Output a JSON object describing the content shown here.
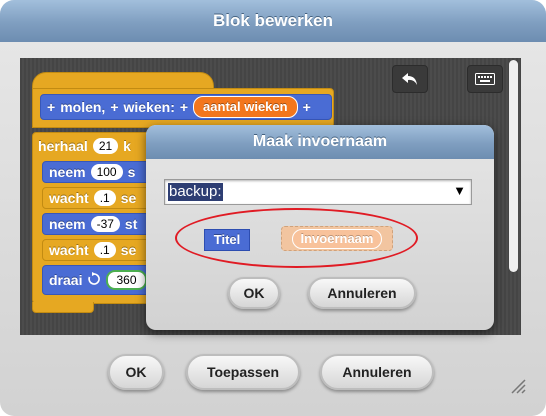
{
  "dialog": {
    "title": "Blok bewerken"
  },
  "toolbar": {
    "undo_icon": "undo-arrow-icon",
    "keyboard_icon": "keyboard-icon"
  },
  "hat_block": {
    "plus1": "+",
    "word1": "molen,",
    "plus2": "+",
    "word2": "wieken:",
    "plus3": "+",
    "param": "aantal wieken",
    "plus4": "+"
  },
  "script": {
    "repeat": {
      "label": "herhaal",
      "count": "21",
      "tail": "k"
    },
    "rows": [
      {
        "kind": "motion",
        "label": "neem",
        "value": "100",
        "tail": "s"
      },
      {
        "kind": "control",
        "label": "wacht",
        "value": ".1",
        "tail": "se"
      },
      {
        "kind": "motion",
        "label": "neem",
        "value": "-37",
        "tail": "st"
      },
      {
        "kind": "control",
        "label": "wacht",
        "value": ".1",
        "tail": "se"
      },
      {
        "kind": "motion",
        "label": "draai",
        "value": "360",
        "tail": ""
      }
    ]
  },
  "inner_dialog": {
    "title": "Maak invoernaam",
    "input_value": "backup:",
    "title_option": "Titel",
    "input_option": "Invoernaam",
    "ok_label": "OK",
    "cancel_label": "Annuleren"
  },
  "buttons": {
    "ok": "OK",
    "apply": "Toepassen",
    "cancel": "Annuleren"
  },
  "colors": {
    "motion": "#4a6cd4",
    "control": "#e6a822",
    "variable": "#f3761d",
    "highlight_ring": "#e01b24"
  }
}
